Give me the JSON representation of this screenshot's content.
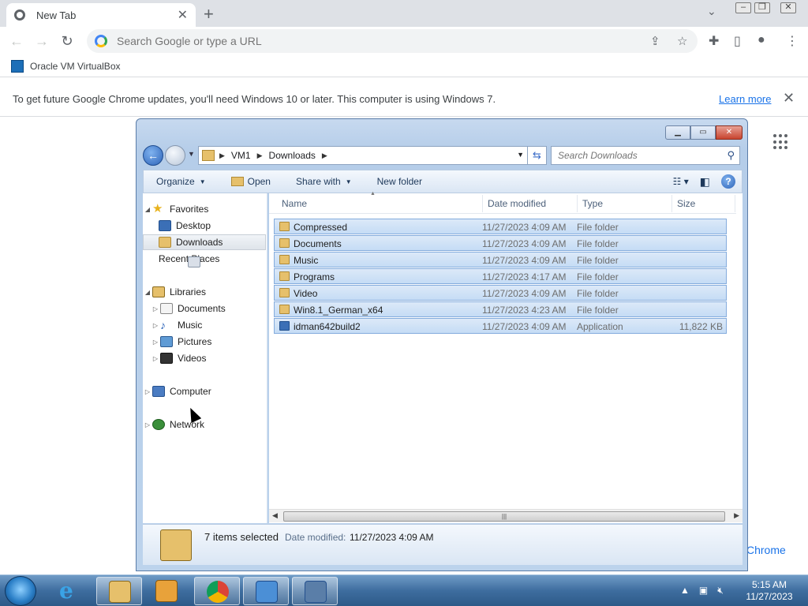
{
  "chrome": {
    "tab_title": "New Tab",
    "omnibox_placeholder": "Search Google or type a URL",
    "bookmark": "Oracle VM VirtualBox",
    "infobar_message": "To get future Google Chrome updates, you'll need Windows 10 or later. This computer is using Windows 7.",
    "infobar_link": "Learn more",
    "page_link": "Chrome"
  },
  "explorer": {
    "breadcrumb": [
      "VM1",
      "Downloads"
    ],
    "search_placeholder": "Search Downloads",
    "commands": {
      "organize": "Organize",
      "open": "Open",
      "share": "Share with",
      "new_folder": "New folder"
    },
    "nav": {
      "favorites": "Favorites",
      "desktop": "Desktop",
      "downloads": "Downloads",
      "recent": "Recent Places",
      "libraries": "Libraries",
      "documents": "Documents",
      "music": "Music",
      "pictures": "Pictures",
      "videos": "Videos",
      "computer": "Computer",
      "network": "Network"
    },
    "columns": [
      "Name",
      "Date modified",
      "Type",
      "Size"
    ],
    "files": [
      {
        "name": "Compressed",
        "date": "11/27/2023 4:09 AM",
        "type": "File folder",
        "size": ""
      },
      {
        "name": "Documents",
        "date": "11/27/2023 4:09 AM",
        "type": "File folder",
        "size": ""
      },
      {
        "name": "Music",
        "date": "11/27/2023 4:09 AM",
        "type": "File folder",
        "size": ""
      },
      {
        "name": "Programs",
        "date": "11/27/2023 4:17 AM",
        "type": "File folder",
        "size": ""
      },
      {
        "name": "Video",
        "date": "11/27/2023 4:09 AM",
        "type": "File folder",
        "size": ""
      },
      {
        "name": "Win8.1_German_x64",
        "date": "11/27/2023 4:23 AM",
        "type": "File folder",
        "size": ""
      },
      {
        "name": "idman642build2",
        "date": "11/27/2023 4:09 AM",
        "type": "Application",
        "size": "11,822 KB"
      }
    ],
    "details": {
      "selected": "7 items selected",
      "date_label": "Date modified:",
      "date_value": "11/27/2023 4:09 AM"
    }
  },
  "taskbar": {
    "time": "5:15 AM",
    "date": "11/27/2023"
  }
}
